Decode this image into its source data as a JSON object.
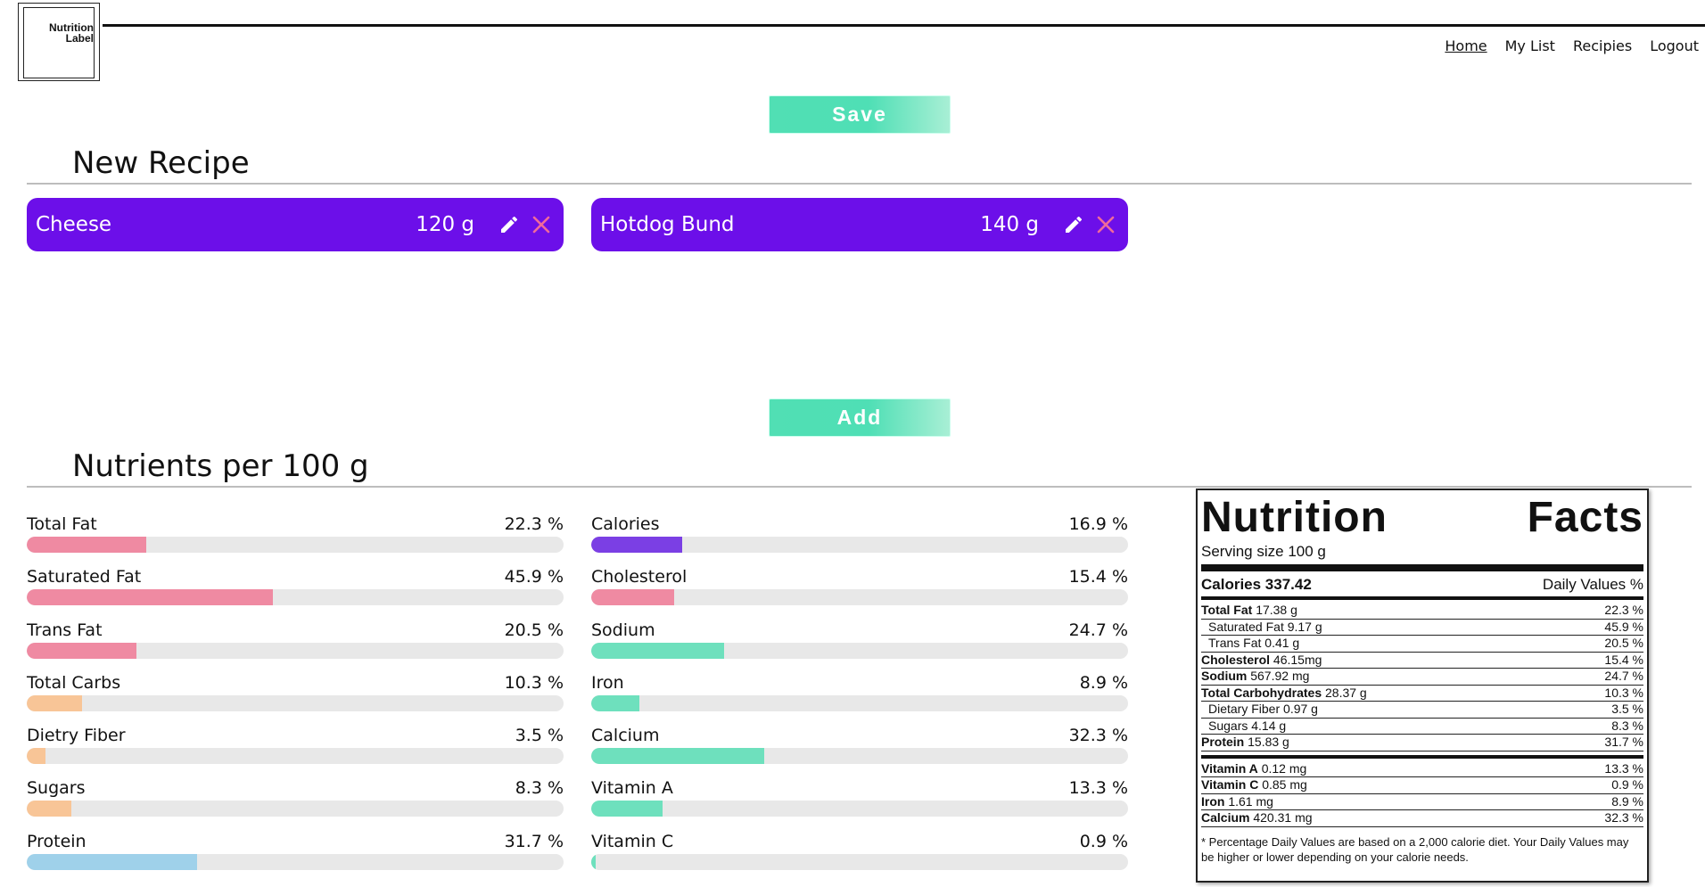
{
  "logo": {
    "line1": "Nutrition",
    "line2": "Label"
  },
  "nav": [
    {
      "label": "Home",
      "active": true
    },
    {
      "label": "My List",
      "active": false
    },
    {
      "label": "Recipies",
      "active": false
    },
    {
      "label": "Logout",
      "active": false
    }
  ],
  "buttons": {
    "save": "Save",
    "add": "Add"
  },
  "recipe": {
    "title": "New Recipe",
    "ingredients": [
      {
        "name": "Cheese",
        "qty": "120 g"
      },
      {
        "name": "Hotdog Bund",
        "qty": "140 g"
      }
    ]
  },
  "nutrients": {
    "title": "Nutrients per 100 g",
    "left": [
      {
        "label": "Total Fat",
        "pct_text": "22.3 %",
        "value": 22.3,
        "color": "#ef8aa2"
      },
      {
        "label": "Saturated Fat",
        "pct_text": "45.9 %",
        "value": 45.9,
        "color": "#ef8aa2"
      },
      {
        "label": "Trans Fat",
        "pct_text": "20.5 %",
        "value": 20.5,
        "color": "#ef8aa2"
      },
      {
        "label": "Total Carbs",
        "pct_text": "10.3 %",
        "value": 10.3,
        "color": "#f8c597"
      },
      {
        "label": "Dietry Fiber",
        "pct_text": "3.5 %",
        "value": 3.5,
        "color": "#f8c597"
      },
      {
        "label": "Sugars",
        "pct_text": "8.3 %",
        "value": 8.3,
        "color": "#f8c597"
      },
      {
        "label": "Protein",
        "pct_text": "31.7 %",
        "value": 31.7,
        "color": "#9fd1ea"
      }
    ],
    "right": [
      {
        "label": "Calories",
        "pct_text": "16.9 %",
        "value": 16.9,
        "color": "#7b3fe4"
      },
      {
        "label": "Cholesterol",
        "pct_text": "15.4 %",
        "value": 15.4,
        "color": "#ef8aa2"
      },
      {
        "label": "Sodium",
        "pct_text": "24.7 %",
        "value": 24.7,
        "color": "#6ee0bd"
      },
      {
        "label": "Iron",
        "pct_text": "8.9 %",
        "value": 8.9,
        "color": "#6ee0bd"
      },
      {
        "label": "Calcium",
        "pct_text": "32.3 %",
        "value": 32.3,
        "color": "#6ee0bd"
      },
      {
        "label": "Vitamin A",
        "pct_text": "13.3 %",
        "value": 13.3,
        "color": "#6ee0bd"
      },
      {
        "label": "Vitamin C",
        "pct_text": "0.9 %",
        "value": 0.9,
        "color": "#6ee0bd"
      }
    ]
  },
  "facts": {
    "title_left": "Nutrition",
    "title_right": "Facts",
    "serving": "Serving size 100 g",
    "calories_label": "Calories 337.42",
    "dv_label": "Daily Values %",
    "rows_main": [
      {
        "name": "Total Fat",
        "amount": "17.38 g",
        "pct": "22.3 %",
        "bold": true,
        "sub": false
      },
      {
        "name": "Saturated Fat",
        "amount": "9.17 g",
        "pct": "45.9 %",
        "bold": false,
        "sub": true
      },
      {
        "name": "Trans Fat",
        "amount": "0.41 g",
        "pct": "20.5 %",
        "bold": false,
        "sub": true
      },
      {
        "name": "Cholesterol",
        "amount": "46.15mg",
        "pct": "15.4 %",
        "bold": true,
        "sub": false
      },
      {
        "name": "Sodium",
        "amount": "567.92 mg",
        "pct": "24.7 %",
        "bold": true,
        "sub": false
      },
      {
        "name": "Total Carbohydrates",
        "amount": "28.37 g",
        "pct": "10.3 %",
        "bold": true,
        "sub": false
      },
      {
        "name": "Dietary Fiber",
        "amount": "0.97 g",
        "pct": "3.5 %",
        "bold": false,
        "sub": true
      },
      {
        "name": "Sugars",
        "amount": "4.14 g",
        "pct": "8.3 %",
        "bold": false,
        "sub": true
      },
      {
        "name": "Protein",
        "amount": "15.83 g",
        "pct": "31.7 %",
        "bold": true,
        "sub": false
      }
    ],
    "rows_vitamins": [
      {
        "name": "Vitamin A",
        "amount": "0.12 mg",
        "pct": "13.3 %"
      },
      {
        "name": "Vitamin C",
        "amount": "0.85 mg",
        "pct": "0.9 %"
      },
      {
        "name": "Iron",
        "amount": "1.61 mg",
        "pct": "8.9 %"
      },
      {
        "name": "Calcium",
        "amount": "420.31 mg",
        "pct": "32.3 %"
      }
    ],
    "footnote": "* Percentage Daily Values are based on a 2,000 calorie diet. Your Daily Values may be higher or lower depending on your calorie needs."
  }
}
